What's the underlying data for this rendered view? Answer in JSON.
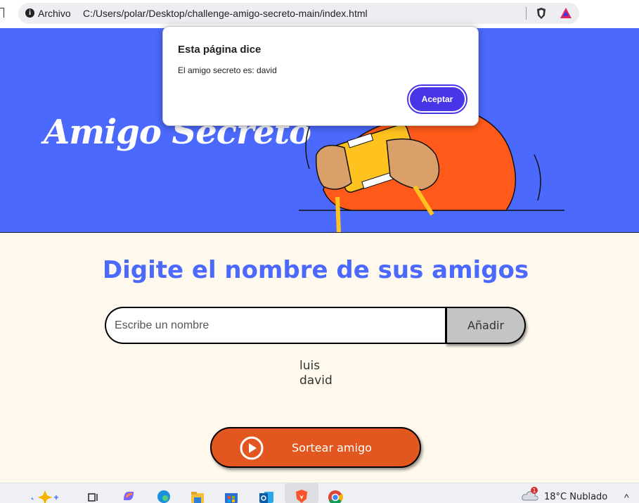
{
  "browser": {
    "site_label": "Archivo",
    "url": "C:/Users/polar/Desktop/challenge-amigo-secreto-main/index.html"
  },
  "hero": {
    "title": "Amigo Secreto"
  },
  "main": {
    "section_title": "Digite el nombre de sus amigos",
    "input_placeholder": "Escribe un nombre",
    "add_button_label": "Añadir",
    "friends": [
      "luis",
      "david"
    ],
    "draw_button_label": "Sortear amigo"
  },
  "dialog": {
    "title": "Esta página dice",
    "message": "El amigo secreto es: david",
    "accept_label": "Aceptar"
  },
  "taskbar": {
    "notification_count": "1",
    "weather": "18°C  Nublado"
  },
  "colors": {
    "hero_bg": "#4b69fd",
    "page_bg": "#fff8ec",
    "accent_orange": "#e2561f",
    "dialog_button": "#4935e8"
  },
  "icons": [
    "bookmark-icon",
    "info-icon",
    "brave-shield-icon",
    "brave-rewards-icon",
    "play-icon",
    "chevron-up-icon",
    "weather-cloud-icon"
  ]
}
